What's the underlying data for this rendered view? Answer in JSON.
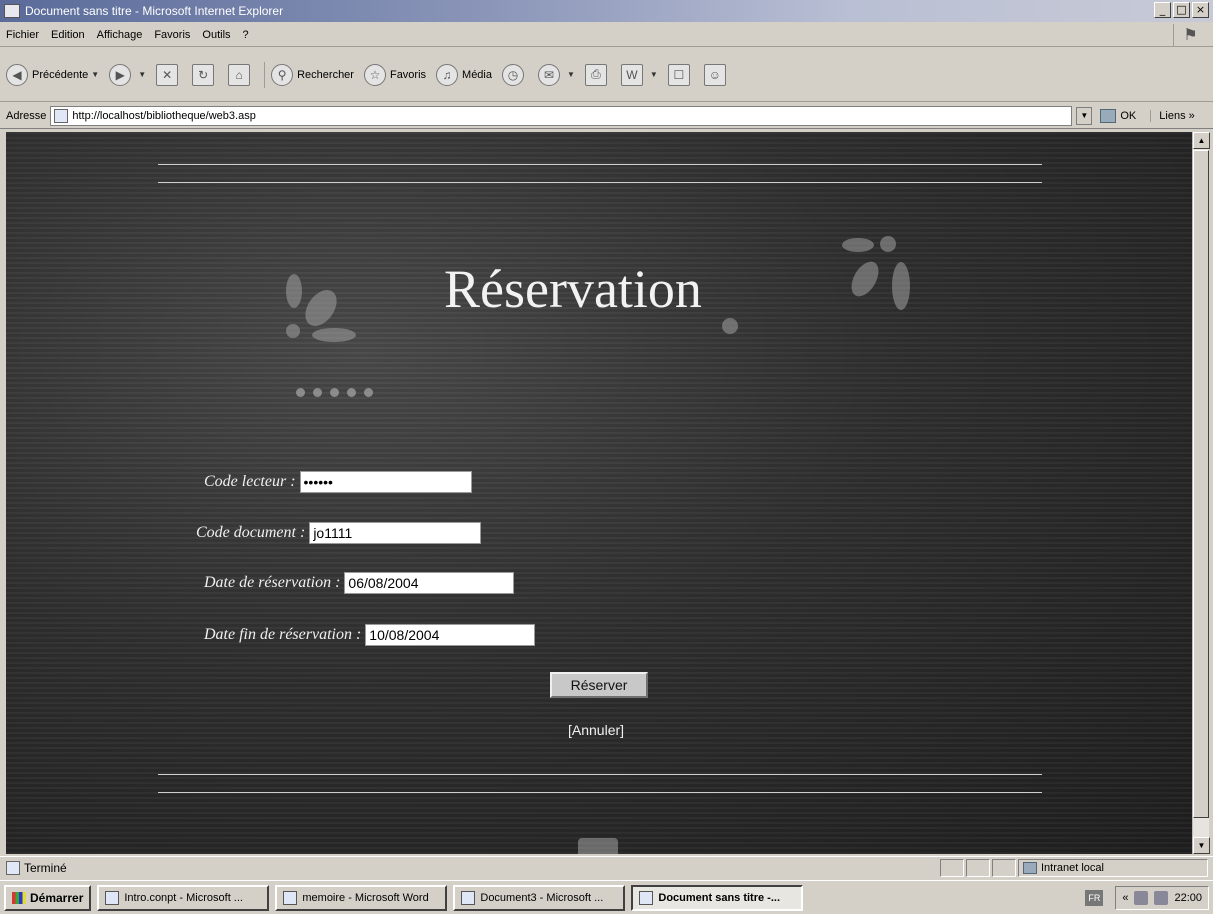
{
  "window": {
    "title": "Document sans titre - Microsoft Internet Explorer",
    "buttons": {
      "minimize": "_",
      "maximize": "□",
      "close": "×"
    }
  },
  "menu": {
    "items": [
      "Fichier",
      "Edition",
      "Affichage",
      "Favoris",
      "Outils",
      "?"
    ]
  },
  "toolbar": {
    "back": "Précédente",
    "search": "Rechercher",
    "favorites": "Favoris",
    "media": "Média"
  },
  "address": {
    "label": "Adresse",
    "url": "http://localhost/bibliotheque/web3.asp",
    "go": "OK",
    "links": "Liens »"
  },
  "page": {
    "title": "Réservation",
    "form": {
      "reader_code": {
        "label": "Code lecteur :",
        "value": "••••••"
      },
      "document_code": {
        "label": "Code document :",
        "value": "jo1111"
      },
      "reservation_date": {
        "label": "Date de réservation :",
        "value": "06/08/2004"
      },
      "end_date": {
        "label": "Date fin de réservation :",
        "value": "10/08/2004"
      }
    },
    "submit": "Réserver",
    "cancel": "[Annuler]"
  },
  "status": {
    "text": "Terminé",
    "zone": "Intranet local"
  },
  "taskbar": {
    "start": "Démarrer",
    "tasks": [
      "Intro.conpt - Microsoft ...",
      "memoire - Microsoft Word",
      "Document3 - Microsoft ...",
      "Document sans titre -..."
    ],
    "lang": "FR",
    "tray_prefix": "«",
    "clock": "22:00"
  }
}
